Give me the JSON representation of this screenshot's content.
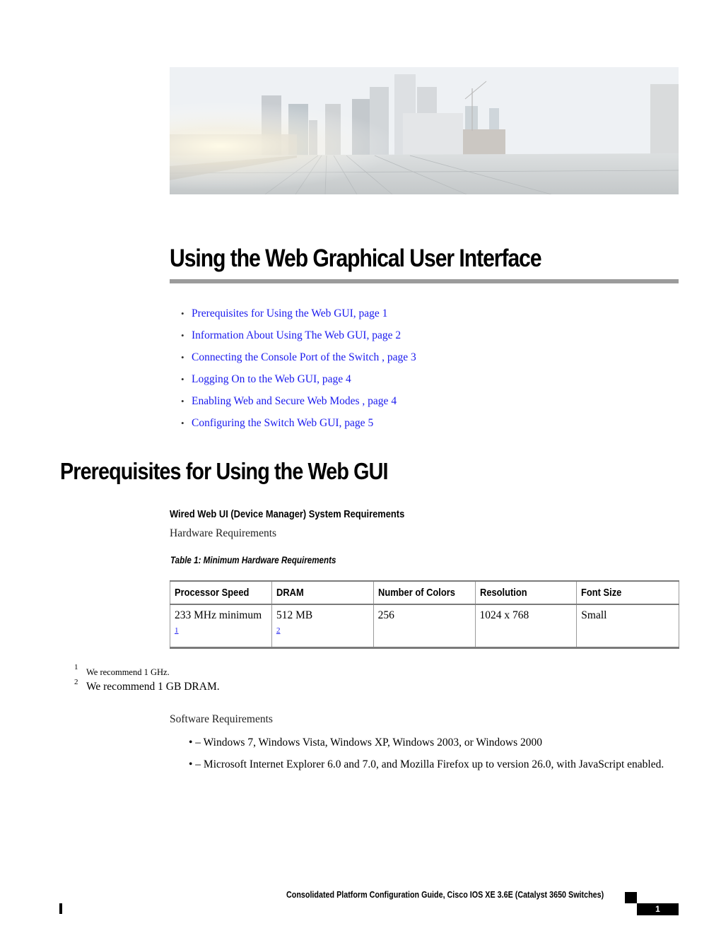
{
  "hero_image": {
    "alt": "city-skyline-bridge-photo"
  },
  "chapter": {
    "title": "Using the Web Graphical User Interface",
    "toc": [
      {
        "label": "Prerequisites for Using the Web GUI,  page  1"
      },
      {
        "label": "Information About Using The Web GUI,  page  2"
      },
      {
        "label": "Connecting the Console Port of the Switch ,  page  3"
      },
      {
        "label": "Logging On to the Web GUI,  page  4"
      },
      {
        "label": "Enabling Web and Secure Web Modes ,  page  4"
      },
      {
        "label": "Configuring the Switch Web GUI,  page  5"
      }
    ],
    "bullet_glyph": "•"
  },
  "section": {
    "title": "Prerequisites for Using the Web GUI",
    "subheading": "Wired Web UI (Device Manager) System Requirements",
    "hardware_label": "Hardware Requirements",
    "table_caption": "Table 1: Minimum Hardware Requirements",
    "table": {
      "headers": [
        "Processor Speed",
        "DRAM",
        "Number of Colors",
        "Resolution",
        "Font Size"
      ],
      "rows": [
        {
          "cells": [
            "233 MHz minimum",
            "512 MB",
            "256",
            "1024 x 768",
            "Small"
          ],
          "footnote_refs": [
            "1",
            "2"
          ]
        }
      ]
    },
    "footnotes": [
      {
        "num": "1",
        "text": "We recommend 1 GHz."
      },
      {
        "num": "2",
        "text": "We recommend 1 GB DRAM."
      }
    ],
    "software_label": "Software Requirements",
    "software_items": [
      "• – Windows 7, Windows Vista, Windows XP, Windows 2003, or Windows 2000",
      "• – Microsoft Internet Explorer 6.0 and 7.0, and Mozilla Firefox up to version 26.0, with JavaScript enabled."
    ]
  },
  "footer": {
    "guide_title": "Consolidated Platform Configuration Guide, Cisco IOS XE 3.6E (Catalyst 3650 Switches)",
    "page_number": "1"
  }
}
